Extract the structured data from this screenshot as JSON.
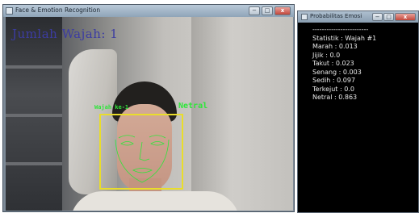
{
  "left_window": {
    "title": "Face & Emotion Recognition",
    "controls": {
      "minimize": "−",
      "maximize": "□",
      "close": "x"
    },
    "overlay_title": "Jumlah Wajah: 1",
    "face_label_left": "Wajah ke-1",
    "face_label_right": "Netral"
  },
  "right_window": {
    "title": "Probabilitas Emosi",
    "controls": {
      "minimize": "−",
      "maximize": "□",
      "close": "x"
    },
    "separator": "------------------------",
    "stats_title": "Statistik : Wajah #1",
    "emotions": [
      {
        "label": "Marah : 0.013"
      },
      {
        "label": "Jijik : 0.0"
      },
      {
        "label": "Takut : 0.023"
      },
      {
        "label": "Senang : 0.003"
      },
      {
        "label": "Sedih : 0.097"
      },
      {
        "label": "Terkejut : 0.0"
      },
      {
        "label": "Netral : 0.863"
      }
    ]
  },
  "colors": {
    "face_box": "#e9dd2b",
    "face_label": "#2ee63a",
    "overlay_title": "#3c3ca2",
    "stats_text": "#e8e8e8"
  }
}
